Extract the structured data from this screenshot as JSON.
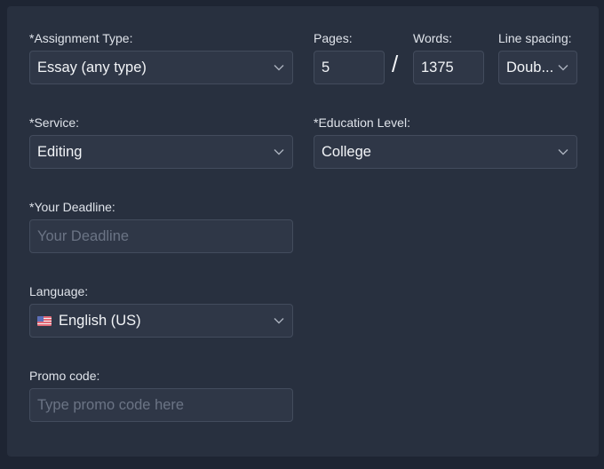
{
  "form": {
    "assignment_type": {
      "label": "*Assignment Type:",
      "value": "Essay (any type)"
    },
    "pages": {
      "label": "Pages:",
      "value": "5"
    },
    "separator": "/",
    "words": {
      "label": "Words:",
      "value": "1375"
    },
    "line_spacing": {
      "label": "Line spacing:",
      "value": "Doub..."
    },
    "service": {
      "label": "*Service:",
      "value": "Editing"
    },
    "education_level": {
      "label": "*Education Level:",
      "value": "College"
    },
    "deadline": {
      "label": "*Your Deadline:",
      "placeholder": "Your Deadline"
    },
    "language": {
      "label": "Language:",
      "value": "English (US)",
      "flag_icon": "us-flag-icon"
    },
    "promo_code": {
      "label": "Promo code:",
      "placeholder": "Type promo code here"
    }
  },
  "colors": {
    "background": "#1e2533",
    "panel": "#28303f",
    "input_bg": "#2f3747",
    "input_border": "#434c5d",
    "placeholder": "#6b7485"
  }
}
